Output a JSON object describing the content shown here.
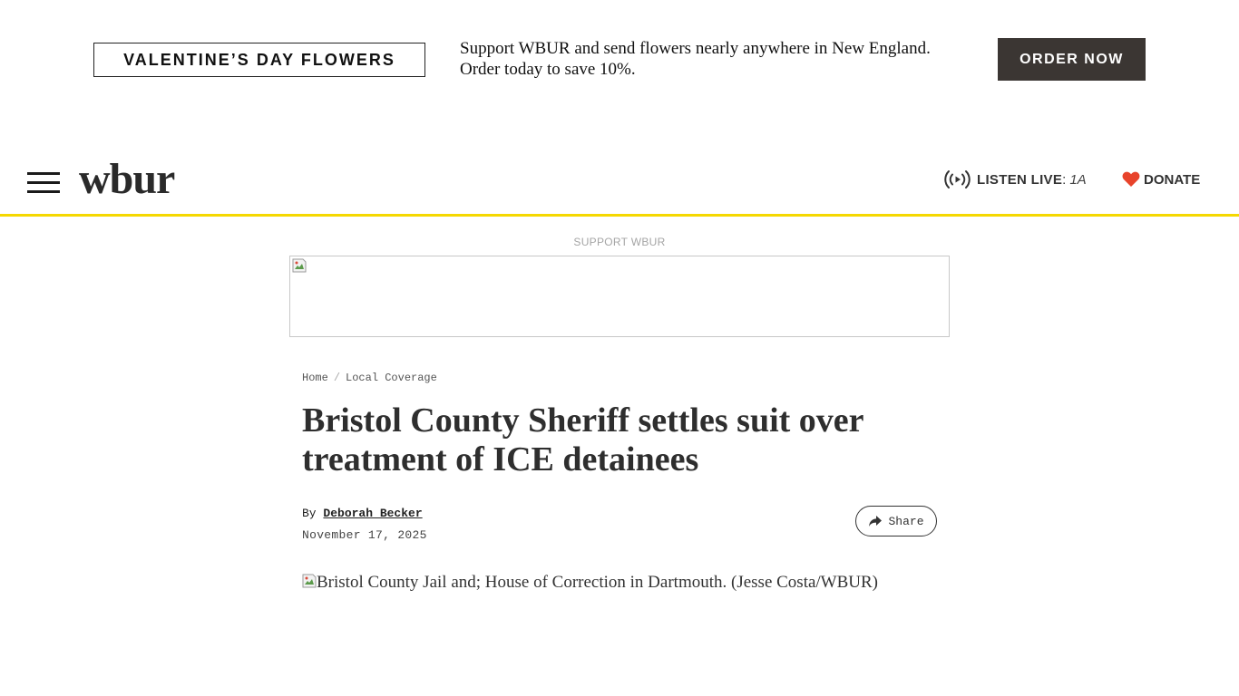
{
  "promo": {
    "title": "VALENTINE’S DAY FLOWERS",
    "text": "Support WBUR and send flowers nearly anywhere in New England. Order today to save 10%.",
    "button_label": "ORDER NOW"
  },
  "header": {
    "logo": "wbur",
    "listen_live_label": "LISTEN LIVE",
    "listen_live_separator": ":",
    "listen_live_station": "1A",
    "donate_label": "DONATE",
    "donate_color": "#e8432b",
    "accent_color": "#f5d800"
  },
  "ad": {
    "label": "SUPPORT WBUR"
  },
  "article": {
    "breadcrumb": [
      "Home",
      "/",
      "Local Coverage"
    ],
    "headline": "Bristol County Sheriff settles suit over treatment of ICE detainees",
    "byline_prefix": "By",
    "author": "Deborah Becker",
    "date": "November 17, 2025",
    "share_label": "Share",
    "hero_image_alt": "Bristol County Jail and; House of Correction in Dartmouth. (Jesse Costa/WBUR)"
  }
}
